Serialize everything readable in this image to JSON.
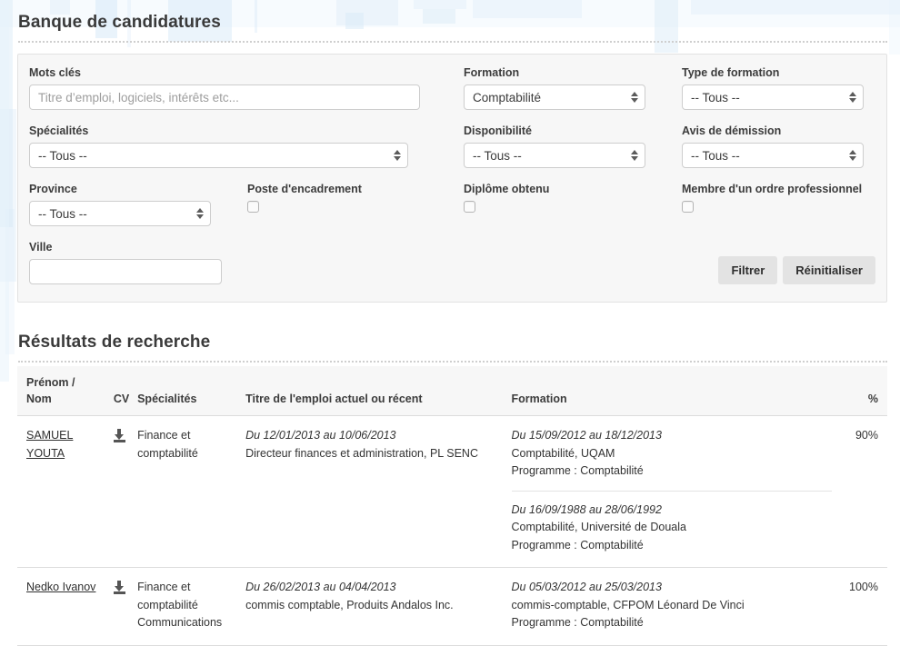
{
  "page": {
    "title": "Banque de candidatures",
    "results_title": "Résultats de recherche"
  },
  "filters": {
    "keywords": {
      "label": "Mots clés",
      "placeholder": "Titre d’emploi, logiciels, intérêts etc...",
      "value": ""
    },
    "specialties": {
      "label": "Spécialités",
      "value": "-- Tous --"
    },
    "province": {
      "label": "Province",
      "value": "-- Tous --"
    },
    "city": {
      "label": "Ville",
      "value": "",
      "placeholder": ""
    },
    "formation": {
      "label": "Formation",
      "value": "Comptabilité"
    },
    "availability": {
      "label": "Disponibilité",
      "value": "-- Tous --"
    },
    "formation_type": {
      "label": "Type de formation",
      "value": "-- Tous --"
    },
    "resignation_notice": {
      "label": "Avis de démission",
      "value": "-- Tous --"
    },
    "management_position": {
      "label": "Poste d'encadrement",
      "checked": false
    },
    "diploma_obtained": {
      "label": "Diplôme obtenu",
      "checked": false
    },
    "professional_order": {
      "label": "Membre d'un ordre professionnel",
      "checked": false
    },
    "buttons": {
      "filter": "Filtrer",
      "reset": "Réinitialiser"
    }
  },
  "results": {
    "columns": {
      "name_line1": "Prénom /",
      "name_line2": "Nom",
      "cv": "CV",
      "specialties": "Spécialités",
      "job_title": "Titre de l'emploi actuel ou récent",
      "formation": "Formation",
      "percent": "%"
    },
    "rows": [
      {
        "name": "SAMUEL YOUTA",
        "name_line1": "SAMUEL",
        "name_line2": "YOUTA",
        "cv_icon": "download-icon",
        "specialties": [
          "Finance et",
          "comptabilité"
        ],
        "experience": {
          "dates": "Du 12/01/2013 au 10/06/2013",
          "title": "Directeur finances et administration, PL SENC"
        },
        "education": [
          {
            "dates": "Du 15/09/2012 au 18/12/2013",
            "school": "Comptabilité, UQAM",
            "program": "Programme : Comptabilité"
          },
          {
            "dates": "Du 16/09/1988 au 28/06/1992",
            "school": "Comptabilité, Université de Douala",
            "program": "Programme : Comptabilité"
          }
        ],
        "percent": "90%"
      },
      {
        "name": "Nedko Ivanov",
        "name_line1": "Nedko Ivanov",
        "name_line2": "",
        "cv_icon": "download-icon",
        "specialties": [
          "Finance et",
          "comptabilité",
          "Communications"
        ],
        "experience": {
          "dates": "Du 26/02/2013 au 04/04/2013",
          "title": "commis comptable, Produits Andalos Inc."
        },
        "education": [
          {
            "dates": "Du 05/03/2012 au 25/03/2013",
            "school": "commis-comptable, CFPOM Léonard De Vinci",
            "program": "Programme : Comptabilité"
          }
        ],
        "percent": "100%"
      }
    ]
  },
  "colors": {
    "panel_bg": "#f7f7f7",
    "panel_border": "#e2e2e2",
    "text": "#333333",
    "accent_bg": "#d7e9f7",
    "button_bg": "#e3e3e3"
  }
}
